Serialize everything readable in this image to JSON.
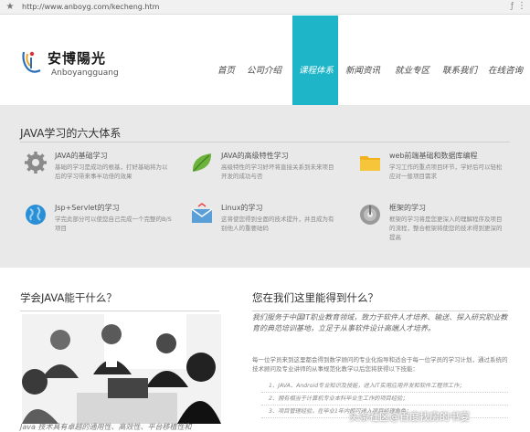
{
  "browser": {
    "url": "http://www.anboyg.com/kecheng.htm"
  },
  "logo": {
    "cn": "安博陽光",
    "en": "Anboyangguang"
  },
  "nav": {
    "items": [
      {
        "label": "首页"
      },
      {
        "label": "公司介绍"
      },
      {
        "label": "课程体系"
      },
      {
        "label": "新闻资讯"
      },
      {
        "label": "就业专区"
      },
      {
        "label": "联系我们"
      },
      {
        "label": "在线咨询"
      }
    ],
    "active_index": 2,
    "active_color": "#1fb5c9"
  },
  "systems": {
    "title": "JAVA学习的六大体系",
    "items": [
      {
        "icon": "gear-icon",
        "title": "JAVA的基础学习",
        "desc": "基础的学习是成功的根基，打好基础将为以后的学习带来事半功倍的效果"
      },
      {
        "icon": "leaf-icon",
        "title": "JAVA的高级特性学习",
        "desc": "高级特性的学习好坏将直接关系到未来项目开发的成功与否"
      },
      {
        "icon": "folder-icon",
        "title": "web前端基础和数据库编程",
        "desc": "学习工作的重点项目环节，学好后可以轻松应对一般项目需求"
      },
      {
        "icon": "globe-icon",
        "title": "Jsp+Servlet的学习",
        "desc": "学完此部分可以使您自己完成一个完整的B/S项目"
      },
      {
        "icon": "mail-icon",
        "title": "Linux的学习",
        "desc": "这将使您得到全面的技术提升，并且成为有别他人的重要砝码"
      },
      {
        "icon": "disc-icon",
        "title": "框架的学习",
        "desc": "框架的学习将是您更深入的理解程序及项目的流程，整合框架将使您的技术得到更深的提高"
      }
    ]
  },
  "left": {
    "heading": "学会JAVA能干什么？",
    "text": "Java 技术具有卓越的通用性、高效性、平台移植性和"
  },
  "right": {
    "heading": "您在我们这里能得到什么？",
    "intro": "我们服务于中国IT职业教育领域，致力于软件人才培养、输送、探入研究职业教育的典范培训基地，立足于从事软件设计高端人才培养。",
    "intro2": "每一位学员来到这里都会得到数学顾问的专业化指导和适合于每一位学员的学习计划，通过系统的技术顾问及专业讲师的从事规范化教学以后您将获得以下技能：",
    "list": [
      "1、JAVA、Android专业知识及技能，进入IT实用应用开发和软件工程师工作；",
      "2、拥有相当于计算机专业本科毕业生工作的项目经验；",
      "3、项目管理经验，在毕业1年内即可进入项目经理角色；"
    ]
  },
  "watermark": "头条社区@百度找房的书宴"
}
